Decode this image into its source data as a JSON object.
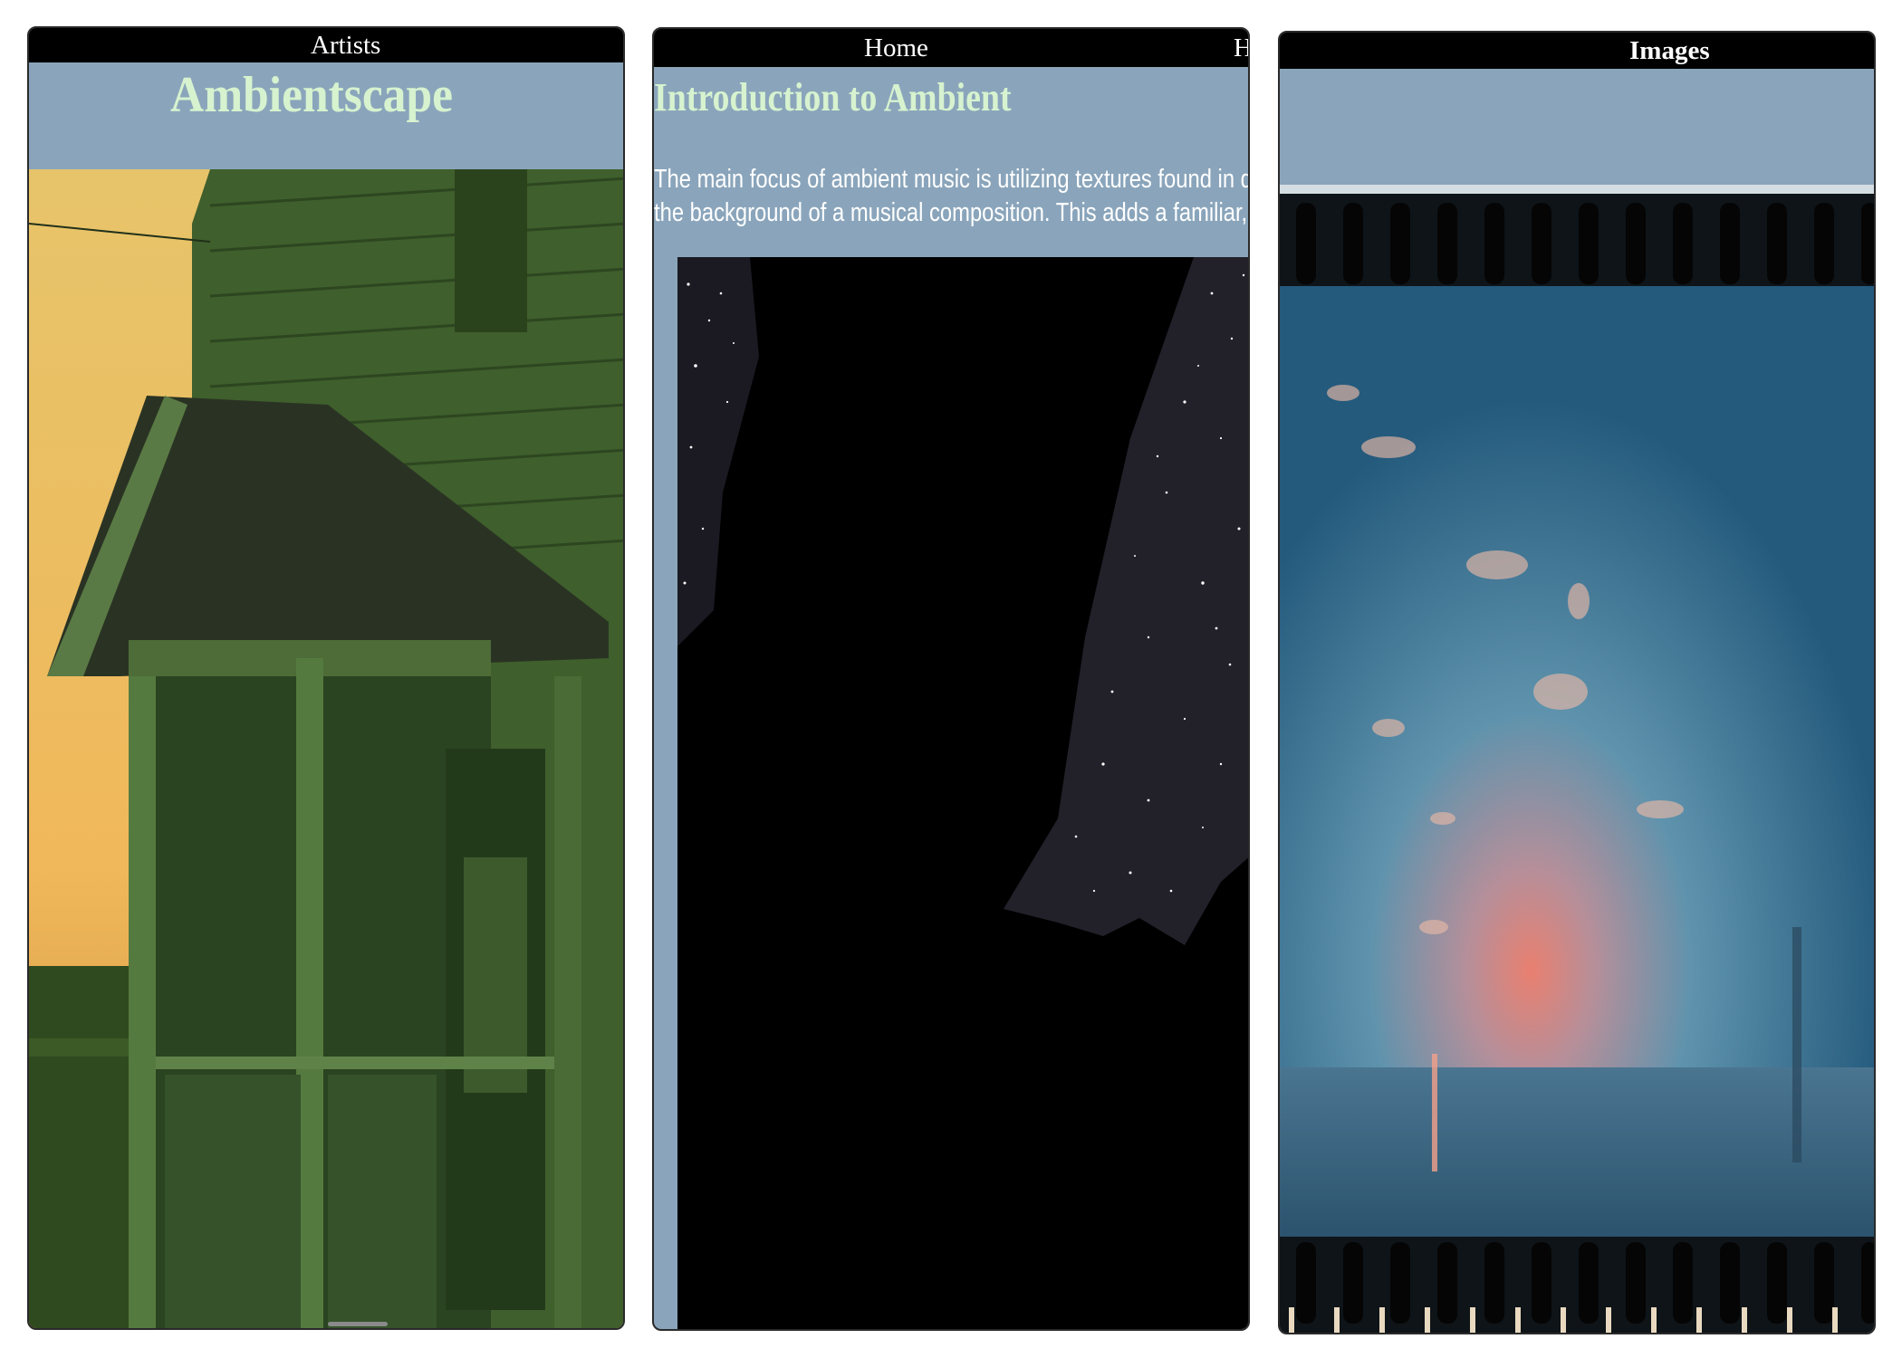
{
  "panels": [
    {
      "nav_links": [
        "Artists"
      ],
      "site_title": "Ambientscape",
      "image_subject": "green-tinted photo of an old wooden house with a porch at sunset"
    },
    {
      "nav_links": [
        "Home",
        "H"
      ],
      "section_title": "Introduction to Ambient",
      "intro_lines": [
        "The main focus of ambient music is utilizing textures found in daily li",
        "the background of a musical composition. This adds a familiar, yet di"
      ],
      "image_subject": "starry night sky framed by a dark canyon silhouette"
    },
    {
      "nav_links": [
        "Images"
      ],
      "image_subject": "sunset over water on a strip of film with sprocket holes"
    }
  ],
  "colors": {
    "nav_bg": "#000000",
    "nav_text": "#ffffff",
    "header_bg": "#8aa5bb",
    "title_text": "#d6f2cf",
    "body_text": "#ffffff"
  }
}
